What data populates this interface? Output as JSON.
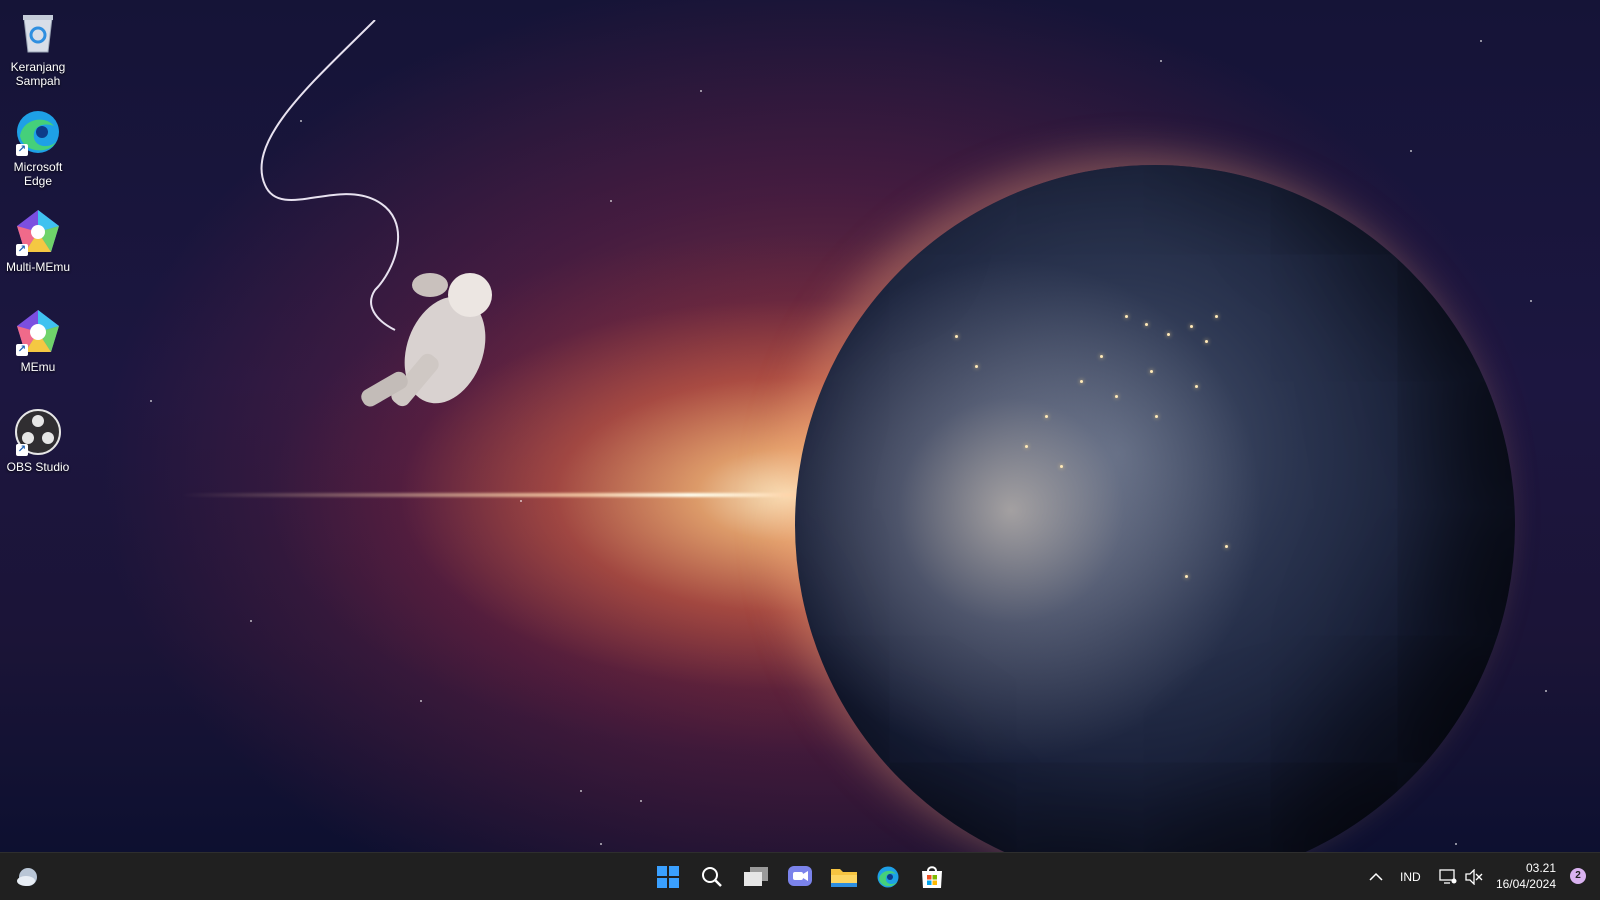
{
  "desktop": {
    "icons": [
      {
        "label": "Keranjang\nSampah",
        "icon": "recycle-bin-icon"
      },
      {
        "label": "Microsoft\nEdge",
        "icon": "edge-icon"
      },
      {
        "label": "Multi-MEmu",
        "icon": "multi-memu-icon"
      },
      {
        "label": "MEmu",
        "icon": "memu-icon"
      },
      {
        "label": "OBS Studio",
        "icon": "obs-studio-icon"
      }
    ]
  },
  "taskbar": {
    "pinned": [
      "windows-start-icon",
      "search-icon",
      "task-view-icon",
      "teams-chat-icon",
      "file-explorer-icon",
      "edge-icon",
      "microsoft-store-icon"
    ],
    "tray": {
      "language": "IND",
      "time": "03.21",
      "date": "16/04/2024",
      "notification_count": "2"
    }
  },
  "colors": {
    "taskbar_bg": "#202020",
    "start_blue": "#3aa0ff",
    "explorer_yellow": "#f6c441"
  }
}
